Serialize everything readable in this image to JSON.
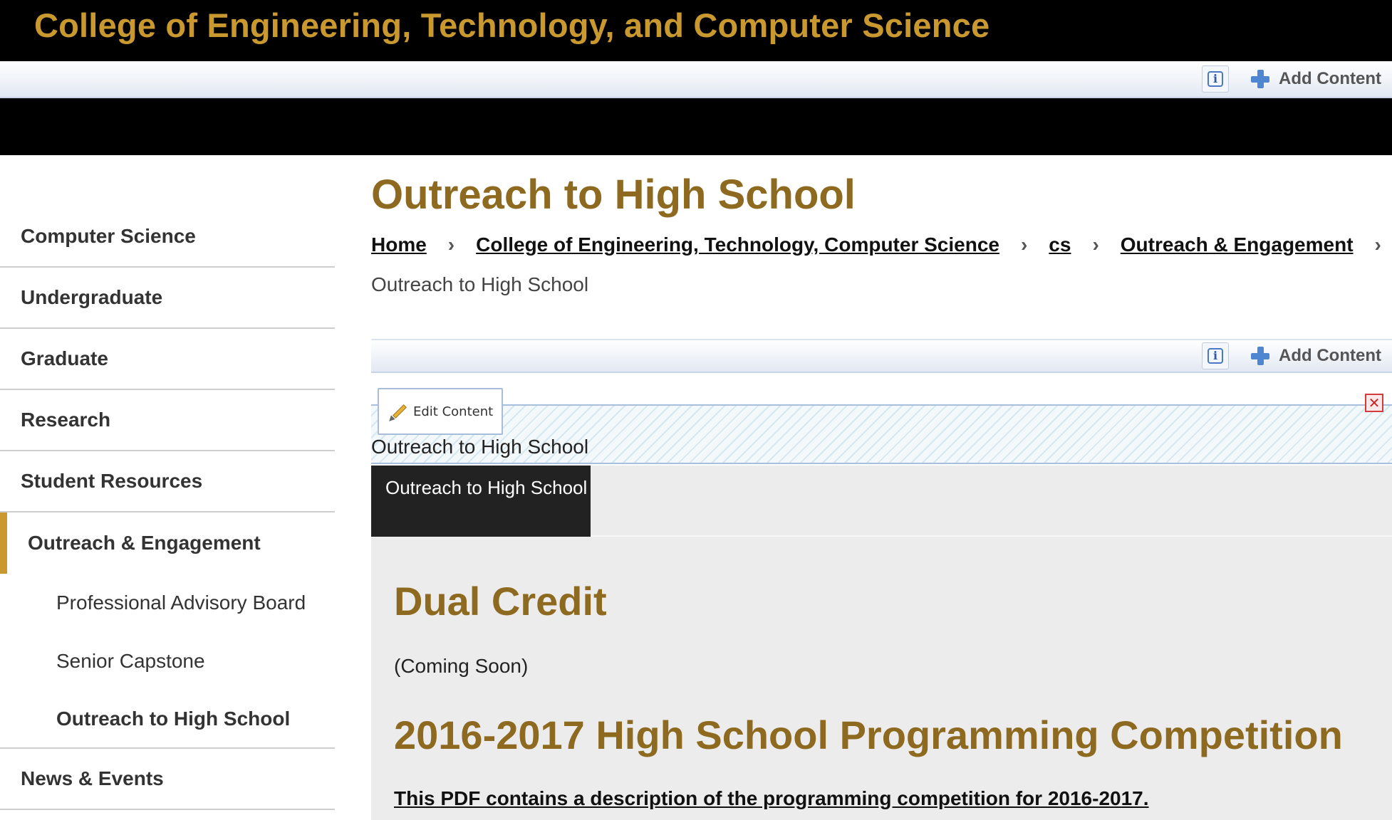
{
  "header": {
    "site_title": "College of Engineering, Technology, and Computer Science"
  },
  "admin_bar": {
    "info_icon": "info-icon",
    "add_icon": "plus-icon",
    "add_content_label": "Add Content"
  },
  "sidebar": {
    "items": [
      {
        "label": "Computer Science"
      },
      {
        "label": "Undergraduate"
      },
      {
        "label": "Graduate"
      },
      {
        "label": "Research"
      },
      {
        "label": "Student Resources"
      },
      {
        "label": "Outreach & Engagement",
        "active": true
      }
    ],
    "subitems": [
      {
        "label": "Professional Advisory Board"
      },
      {
        "label": "Senior Capstone"
      },
      {
        "label": "Outreach to High School",
        "current": true
      }
    ],
    "after": [
      {
        "label": "News & Events"
      }
    ],
    "active_color": "#c9992f"
  },
  "main": {
    "page_title": "Outreach to High School",
    "breadcrumb": [
      {
        "label": "Home"
      },
      {
        "label": "College of Engineering, Technology, Computer Science"
      },
      {
        "label": "cs"
      },
      {
        "label": "Outreach & Engagement"
      }
    ],
    "breadcrumb_separator": "›",
    "breadcrumb_current": "Outreach to High School",
    "content_admin": {
      "add_content_label": "Add Content"
    },
    "edit_zone": {
      "edit_button_label": "Edit Content",
      "close_symbol": "✕",
      "zone_title": "Outreach to High School"
    },
    "tabs": [
      {
        "label": "Outreach to High School",
        "active": true
      }
    ],
    "sections": {
      "dual_credit_heading": "Dual Credit",
      "dual_credit_text": "(Coming Soon)",
      "competition_heading": "2016-2017 High School Programming Competition",
      "competition_link": "This PDF contains a description of the programming competition for 2016-2017."
    }
  },
  "colors": {
    "gold": "#c9992f",
    "heading_gold": "#8d6a1f",
    "black": "#000000",
    "admin_blue": "#4f86d2"
  }
}
